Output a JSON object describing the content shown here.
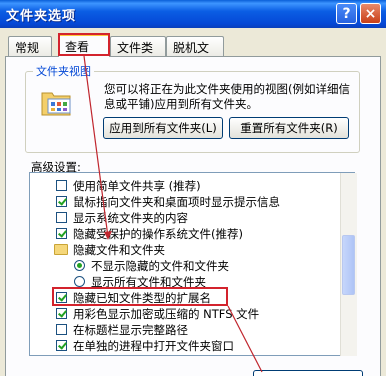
{
  "window": {
    "title": "文件夹选项"
  },
  "tabs": [
    {
      "label": "常规"
    },
    {
      "label": "查看"
    },
    {
      "label": "文件类型"
    },
    {
      "label": "脱机文件"
    }
  ],
  "folder_views": {
    "group_label": "文件夹视图",
    "description": "您可以将正在为此文件夹使用的视图(例如详细信息或平铺)应用到所有文件夹。",
    "apply_button": "应用到所有文件夹(L)",
    "reset_button": "重置所有文件夹(R)"
  },
  "advanced": {
    "label": "高级设置:",
    "items": [
      {
        "type": "checkbox",
        "checked": false,
        "label": "使用简单文件共享 (推荐)"
      },
      {
        "type": "checkbox",
        "checked": true,
        "label": "鼠标指向文件夹和桌面项时显示提示信息"
      },
      {
        "type": "checkbox",
        "checked": false,
        "label": "显示系统文件夹的内容"
      },
      {
        "type": "checkbox",
        "checked": true,
        "label": "隐藏受保护的操作系统文件(推荐)"
      },
      {
        "type": "folder",
        "label": "隐藏文件和文件夹"
      },
      {
        "type": "radio",
        "checked": true,
        "label": "不显示隐藏的文件和文件夹"
      },
      {
        "type": "radio",
        "checked": false,
        "label": "显示所有文件和文件夹"
      },
      {
        "type": "checkbox",
        "checked": true,
        "label": "隐藏已知文件类型的扩展名"
      },
      {
        "type": "checkbox",
        "checked": true,
        "label": "用彩色显示加密或压缩的 NTFS 文件"
      },
      {
        "type": "checkbox",
        "checked": false,
        "label": "在标题栏显示完整路径"
      },
      {
        "type": "checkbox",
        "checked": true,
        "label": "在单独的进程中打开文件夹窗口"
      }
    ]
  },
  "colors": {
    "titlebar": "#0b5ee4",
    "highlight": "#d3232d",
    "group_label": "#0046d5"
  },
  "icons": {
    "help": "?",
    "close": "×"
  }
}
